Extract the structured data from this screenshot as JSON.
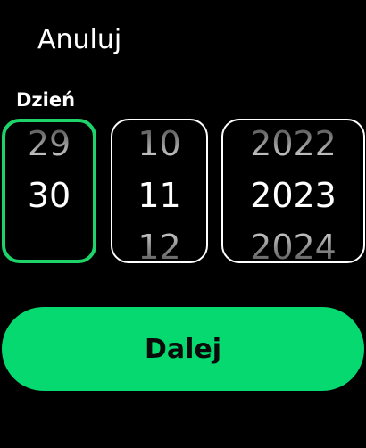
{
  "header": {
    "cancel_label": "Anuluj"
  },
  "picker": {
    "label": "Dzień",
    "day": {
      "prev": "29",
      "current": "30",
      "next": ""
    },
    "month": {
      "prev": "10",
      "current": "11",
      "next": "12"
    },
    "year": {
      "prev": "2022",
      "current": "2023",
      "next": "2024"
    },
    "active_wheel": "day"
  },
  "footer": {
    "next_label": "Dalej"
  },
  "colors": {
    "background": "#000000",
    "accent": "#06d96f",
    "active_border": "#1ed36a",
    "wheel_border": "#ffffff"
  }
}
